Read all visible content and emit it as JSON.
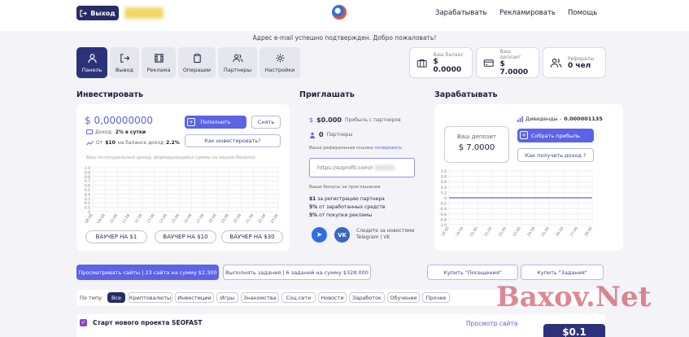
{
  "header": {
    "logout_label": "Выход",
    "nav": [
      "Зарабатывать",
      "Рекламировать",
      "Помощь"
    ]
  },
  "notice": "Адрес e-mail успешно подтвержден. Добро пожаловать!",
  "menu": [
    "Панель",
    "Вывод",
    "Реклама",
    "Операции",
    "Партнеры",
    "Настройки"
  ],
  "stats": [
    {
      "label": "Ваш баланс",
      "value": "$ 0.0000"
    },
    {
      "label": "Ваш депозит",
      "value": "$ 7.0000"
    },
    {
      "label": "Рефералы",
      "value": "0 чел"
    }
  ],
  "invest": {
    "title": "Инвестировать",
    "amount": "$ 0,00000000",
    "income_label": "Доход:",
    "income_value": "2% в сутки",
    "from_label": "От",
    "from_value": "$10",
    "from_suffix": "на балансе доход",
    "from_rate": "2.2%",
    "topup_label": "Пополнить",
    "withdraw_label": "Снять",
    "how_label": "Как инвестировать?",
    "chart_note": "Ваш потенциальный доход, формирующийся суммы на вашем балансе",
    "vouchers": [
      "ВАУЧЕР НА $1",
      "ВАУЧЕР НА $10",
      "ВАУЧЕР НА $30"
    ]
  },
  "chart_data": [
    {
      "type": "line",
      "x": [
        "08.08",
        "09.08",
        "10.08",
        "11.08",
        "12.08",
        "13.08",
        "14.08",
        "15.08",
        "16.08",
        "17.08",
        "18.08",
        "19.08",
        "20.08",
        "21.08",
        "22.08",
        "23.08"
      ],
      "y_ticks": [
        "1.0",
        "0.9",
        "0.8",
        "0.7",
        "0.6",
        "0.5",
        "0.4",
        "0.3",
        "0.2",
        "0.1",
        "0"
      ],
      "ylim": [
        0,
        1.0
      ],
      "values": [
        0,
        0,
        0,
        0,
        0,
        0,
        0,
        0,
        0,
        0,
        0,
        0,
        0,
        0,
        0,
        0
      ]
    },
    {
      "type": "line",
      "x": [
        "18.06",
        "19.06",
        "20.06",
        "21.06",
        "22.06",
        "23.06",
        "24.06",
        "25.06",
        "26.06",
        "27.06",
        "28.06"
      ],
      "y_ticks": [
        "1.0",
        "0.8",
        "0.6",
        "0.4",
        "0.2",
        "0",
        "-0.2",
        "-0.4",
        "-0.6",
        "-0.8",
        "-1.0"
      ],
      "ylim": [
        -1.0,
        1.0
      ],
      "values": [
        0,
        0,
        0,
        0,
        0,
        0,
        0,
        0,
        0,
        0,
        0
      ],
      "color": "#5b63e6"
    }
  ],
  "invite": {
    "title": "Приглашать",
    "profit_value": "$0.000",
    "profit_label": "Прибыль с партнеров",
    "partners_value": "0",
    "partners_label": "Партнеры",
    "ref_label": "Ваша реферальная ссылка",
    "ref_link_word": "попировать",
    "ref_url": "https://ezprofit.com/r",
    "bonus_title": "Ваши бонусы за приглашения",
    "bonuses": [
      {
        "value": "$1",
        "text": "за регистрацию партнера"
      },
      {
        "value": "5%",
        "text": "от заработанных средств"
      },
      {
        "value": "5%",
        "text": "от покупки рекламы"
      }
    ],
    "news_line1": "Следите за новостями",
    "news_line2": "Telegram | VK",
    "vk_label": "VK"
  },
  "earn": {
    "title": "Зарабатывать",
    "dividends_label": "Дивиденды -",
    "dividends_value": "0.000001135",
    "deposit_label": "Ваш депозит",
    "deposit_value": "$ 7.0000",
    "collect_label": "Собрать прибыль",
    "how_label": "Как получить доход ?"
  },
  "actions": {
    "view_sites": "Просматривать сайты | 23 сайта на сумму $2.300",
    "do_tasks": "Выполнять задания | 6 заданий на сумму $328.000",
    "buy_visits": "Купить \"Посещения\"",
    "buy_tasks": "Купить \"Задания\""
  },
  "filters": {
    "label": "По типу",
    "items": [
      "Все",
      "Криптовалюты",
      "Инвестиции",
      "Игры",
      "Знакомства",
      "Соц.сети",
      "Новости",
      "Заработок",
      "Обучение",
      "Прочее"
    ]
  },
  "task": {
    "title": "Старт нового проекта SEOFAST",
    "link": "Просмотр сайта",
    "reward": "$0.1"
  },
  "watermark": "Baxov.Net"
}
